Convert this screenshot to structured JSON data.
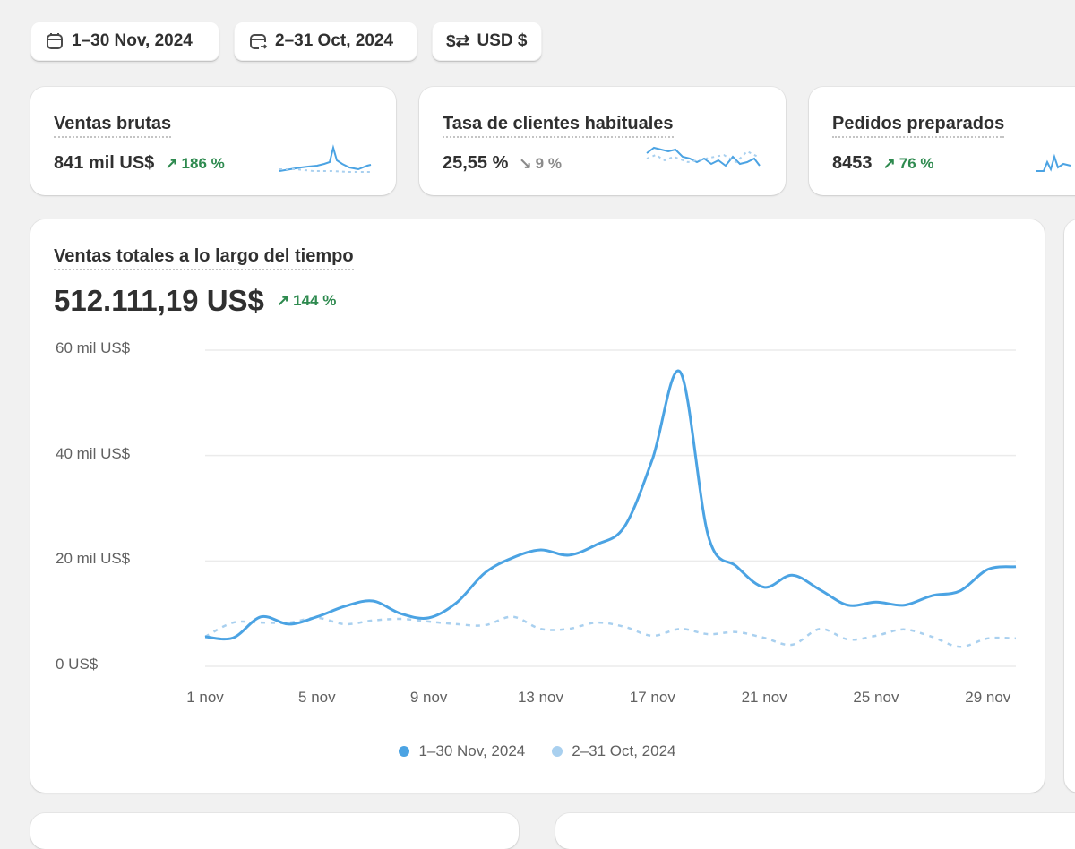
{
  "filters": {
    "current_range": "1–30 Nov, 2024",
    "compare_range": "2–31 Oct, 2024",
    "currency": "USD $"
  },
  "metrics": [
    {
      "title": "Ventas brutas",
      "value": "841 mil US$",
      "delta": "186 %",
      "direction": "up"
    },
    {
      "title": "Tasa de clientes habituales",
      "value": "25,55 %",
      "delta": "9 %",
      "direction": "down"
    },
    {
      "title": "Pedidos preparados",
      "value": "8453",
      "delta": "76 %",
      "direction": "up"
    }
  ],
  "colors": {
    "current": "#4ba3e3",
    "previous": "#a9d0ef",
    "up": "#2e8a4f",
    "down": "#8a8a8a"
  },
  "chart_data": {
    "type": "line",
    "title": "Ventas totales a lo largo del tiempo",
    "total": "512.111,19 US$",
    "delta": "144 %",
    "ylim": [
      0,
      60
    ],
    "yticks": [
      {
        "v": 0,
        "label": "0 US$"
      },
      {
        "v": 20,
        "label": "20 mil US$"
      },
      {
        "v": 40,
        "label": "40 mil US$"
      },
      {
        "v": 60,
        "label": "60 mil US$"
      }
    ],
    "xticks": [
      {
        "d": 1,
        "label": "1 nov"
      },
      {
        "d": 5,
        "label": "5 nov"
      },
      {
        "d": 9,
        "label": "9 nov"
      },
      {
        "d": 13,
        "label": "13 nov"
      },
      {
        "d": 17,
        "label": "17 nov"
      },
      {
        "d": 21,
        "label": "21 nov"
      },
      {
        "d": 25,
        "label": "25 nov"
      },
      {
        "d": 29,
        "label": "29 nov"
      }
    ],
    "unit": "mil US$",
    "series": [
      {
        "name": "1–30 Nov, 2024",
        "style": "solid",
        "values": [
          5.6,
          5.4,
          9.4,
          8.0,
          9.4,
          11.4,
          12.4,
          10.0,
          9.2,
          12.1,
          17.7,
          20.6,
          22.1,
          21.1,
          23.1,
          26.5,
          39.3,
          55.8,
          24.7,
          19.0,
          15.0,
          17.3,
          14.5,
          11.6,
          12.2,
          11.6,
          13.4,
          14.3,
          18.4,
          18.9
        ]
      },
      {
        "name": "2–31 Oct, 2024",
        "style": "dashed",
        "values": [
          5.6,
          8.3,
          8.3,
          8.3,
          9.2,
          8.0,
          8.7,
          9.0,
          8.5,
          8.0,
          7.8,
          9.4,
          7.1,
          7.1,
          8.3,
          7.5,
          5.8,
          7.1,
          6.1,
          6.5,
          5.4,
          4.1,
          7.1,
          5.1,
          5.8,
          7.0,
          5.6,
          3.7,
          5.3,
          5.3
        ]
      }
    ],
    "legend": "bottom-center"
  }
}
